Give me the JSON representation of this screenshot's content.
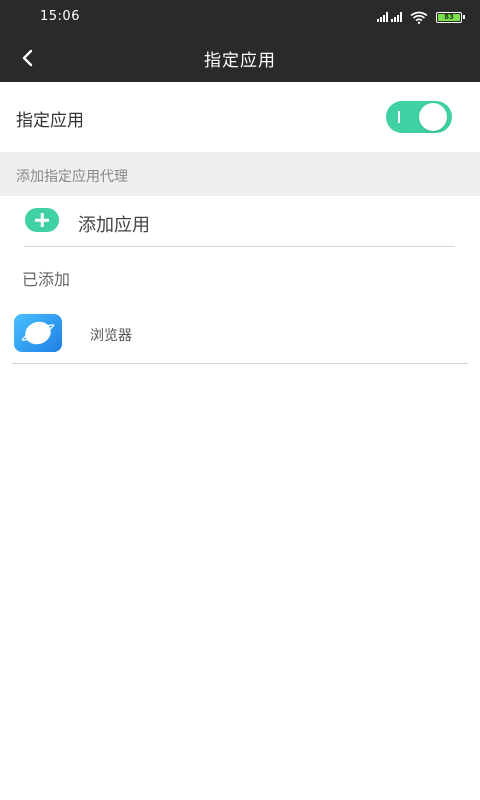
{
  "status_bar": {
    "time": "15:06",
    "battery_text": "83",
    "icons": [
      "signal-icon",
      "wifi-icon",
      "battery-icon"
    ]
  },
  "nav": {
    "back_icon": "chevron-left-icon",
    "title": "指定应用"
  },
  "toggle": {
    "label": "指定应用",
    "enabled": true,
    "accent_color": "#3fd0a3"
  },
  "section": {
    "header": "添加指定应用代理"
  },
  "add_app": {
    "icon": "plus-icon",
    "label": "添加应用"
  },
  "added": {
    "label": "已添加",
    "apps": [
      {
        "name": "浏览器",
        "icon": "browser-app-icon"
      }
    ]
  }
}
